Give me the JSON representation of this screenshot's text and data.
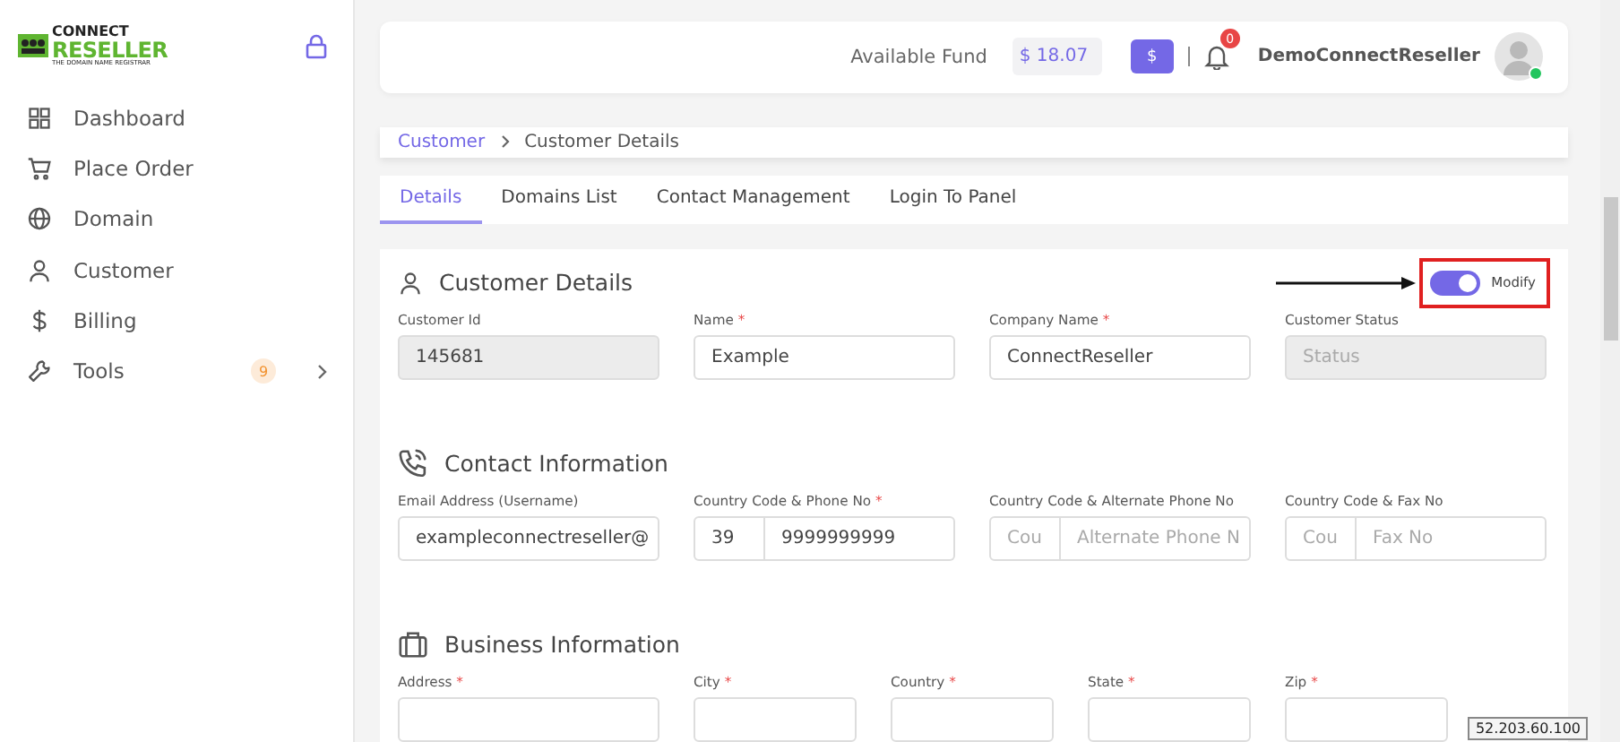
{
  "logo": {
    "line_1": "CONNECT",
    "line_2": "RESELLER",
    "tagline": "THE DOMAIN NAME REGISTRAR"
  },
  "sidebar": {
    "items": [
      {
        "label": "Dashboard"
      },
      {
        "label": "Place Order"
      },
      {
        "label": "Domain"
      },
      {
        "label": "Customer"
      },
      {
        "label": "Billing"
      },
      {
        "label": "Tools",
        "badge": "9"
      }
    ]
  },
  "topbar": {
    "fund_label": "Available Fund",
    "fund_value": "$ 18.07",
    "fund_button": "$",
    "notification_count": "0",
    "username": "DemoConnectReseller",
    "online": true
  },
  "breadcrumb": [
    "Customer",
    "Customer Details"
  ],
  "tabs": [
    {
      "label": "Details",
      "selected": true
    },
    {
      "label": "Domains List",
      "selected": false
    },
    {
      "label": "Contact Management",
      "selected": false
    },
    {
      "label": "Login To Panel",
      "selected": false
    }
  ],
  "modify_toggle": {
    "label": "Modify",
    "on": true
  },
  "sections": [
    {
      "title": "Customer Details",
      "fields": [
        {
          "label": "Customer Id",
          "value": "145681",
          "disabled": true
        },
        {
          "label": "Name",
          "mark": "*",
          "value": "Example",
          "disabled": false
        },
        {
          "label": "Company Name",
          "mark": "*",
          "value": "ConnectReseller",
          "disabled": false
        },
        {
          "label": "Customer Status",
          "placeholder": "Status",
          "disabled": true
        }
      ]
    },
    {
      "title": "Contact Information",
      "fields": [
        {
          "label": "Email Address (Username)",
          "value": "exampleconnectreseller@",
          "disabled": false
        },
        {
          "label": "Country Code & Phone No",
          "mark": "*",
          "code_value": "39",
          "value": "9999999999",
          "disabled": false
        },
        {
          "label": "Country Code & Alternate Phone No",
          "code_placeholder": "Cou",
          "placeholder": "Alternate Phone N",
          "disabled": false
        },
        {
          "label": "Country Code & Fax No",
          "code_placeholder": "Cou",
          "placeholder": "Fax No",
          "disabled": false
        }
      ]
    },
    {
      "title": "Business Information",
      "fields": [
        {
          "label": "Address",
          "mark": "*",
          "disabled": false
        },
        {
          "label": "City",
          "mark": "*",
          "disabled": false
        },
        {
          "label": "Country",
          "mark": "*",
          "disabled": false
        },
        {
          "label": "State",
          "mark": "*",
          "disabled": false
        },
        {
          "label": "Zip",
          "mark": "*",
          "disabled": false
        }
      ]
    }
  ],
  "ip_tooltip": "52.203.60.100"
}
